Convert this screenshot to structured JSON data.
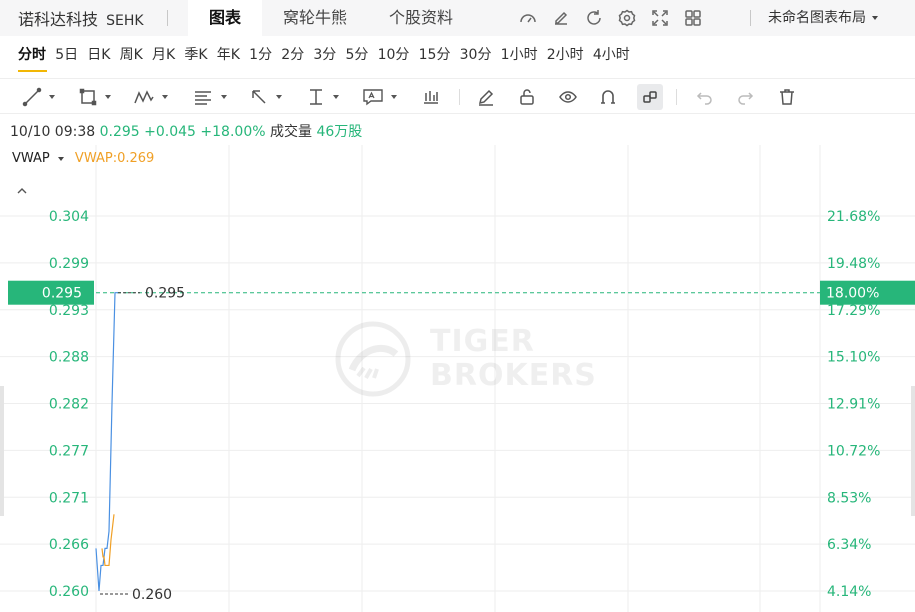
{
  "header": {
    "stock_name": "诺科达科技",
    "exchange": "SEHK",
    "tabs": [
      {
        "label": "图表",
        "active": true
      },
      {
        "label": "窝轮牛熊",
        "active": false
      },
      {
        "label": "个股资料",
        "active": false
      }
    ],
    "icons": [
      "gauge-icon",
      "edit-icon",
      "refresh-icon",
      "settings-icon",
      "fullscreen-icon",
      "layout-grid-icon"
    ],
    "layout_name": "未命名图表布局"
  },
  "periods": [
    {
      "label": "分时",
      "active": true
    },
    {
      "label": "5日"
    },
    {
      "label": "日K"
    },
    {
      "label": "周K"
    },
    {
      "label": "月K"
    },
    {
      "label": "季K"
    },
    {
      "label": "年K"
    },
    {
      "label": "1分"
    },
    {
      "label": "2分"
    },
    {
      "label": "3分"
    },
    {
      "label": "5分"
    },
    {
      "label": "10分"
    },
    {
      "label": "15分"
    },
    {
      "label": "30分"
    },
    {
      "label": "1小时"
    },
    {
      "label": "2小时"
    },
    {
      "label": "4小时"
    }
  ],
  "toolbar": {
    "tools": [
      "line-tool-icon",
      "rectangle-tool-icon",
      "wave-tool-icon",
      "fib-tool-icon",
      "arrow-tool-icon",
      "vertical-line-tool-icon",
      "text-tool-icon",
      "bars-tool-icon",
      "pencil-icon",
      "lock-icon",
      "eye-icon",
      "magnet-icon",
      "link-icon",
      "undo-icon",
      "redo-icon",
      "trash-icon"
    ]
  },
  "quote": {
    "time": "10/10 09:38",
    "price": "0.295",
    "change": "+0.045",
    "change_pct": "+18.00%",
    "volume_label": "成交量",
    "volume": "46万股"
  },
  "indicator": {
    "name": "VWAP",
    "value_text": "VWAP:0.269"
  },
  "colors": {
    "up": "#27b67a",
    "vwap": "#f0a026",
    "price_line": "#4a90e2",
    "grid": "#eeeeee",
    "active_tab_underline": "#f2b705"
  },
  "watermark": {
    "line1": "TIGER",
    "line2": "BROKERS"
  },
  "chart_data": {
    "type": "line",
    "title": "",
    "y_ticks": [
      "0.304",
      "0.299",
      "0.293",
      "0.288",
      "0.282",
      "0.277",
      "0.271",
      "0.266",
      "0.260"
    ],
    "pct_ticks": [
      "21.68%",
      "19.48%",
      "17.29%",
      "15.10%",
      "12.91%",
      "10.72%",
      "8.53%",
      "6.34%",
      "4.14%"
    ],
    "ylim": [
      0.26,
      0.304
    ],
    "last_price": 0.295,
    "last_price_label": "0.295",
    "last_pct_label": "18.00%",
    "high_label": "0.295",
    "low_label": "0.260",
    "series": [
      {
        "name": "price",
        "values": [
          0.265,
          0.26,
          0.263,
          0.263,
          0.265,
          0.265,
          0.267,
          0.282,
          0.295,
          0.295
        ]
      },
      {
        "name": "VWAP",
        "values": [
          0.265,
          0.264,
          0.264,
          0.263,
          0.263,
          0.263,
          0.266,
          0.269
        ]
      }
    ]
  }
}
